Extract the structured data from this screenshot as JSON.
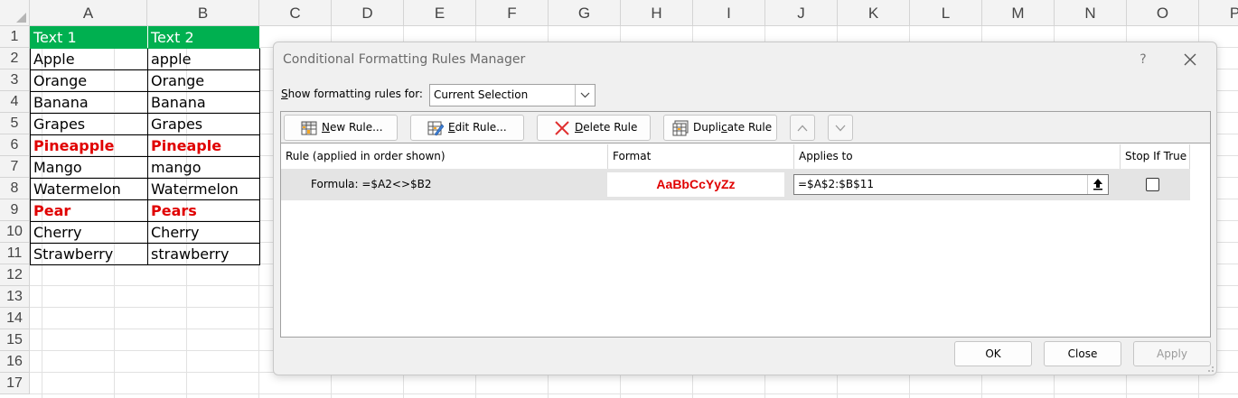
{
  "sheet": {
    "columns": [
      "A",
      "B",
      "C",
      "D",
      "E",
      "F",
      "G",
      "H",
      "I",
      "J",
      "K",
      "L",
      "M",
      "N",
      "O",
      "P"
    ],
    "rows": [
      "1",
      "2",
      "3",
      "4",
      "5",
      "6",
      "7",
      "8",
      "9",
      "10",
      "11",
      "12",
      "13",
      "14",
      "15",
      "16",
      "17"
    ],
    "header": {
      "a": "Text 1",
      "b": "Text 2"
    },
    "data": [
      {
        "a": "Apple",
        "b": "apple",
        "hl": false
      },
      {
        "a": "Orange",
        "b": "Orange",
        "hl": false
      },
      {
        "a": "Banana",
        "b": "Banana",
        "hl": false
      },
      {
        "a": "Grapes",
        "b": "Grapes",
        "hl": false
      },
      {
        "a": "Pineapple",
        "b": "Pineaple",
        "hl": true
      },
      {
        "a": "Mango",
        "b": "mango",
        "hl": false
      },
      {
        "a": "Watermelon",
        "b": "Watermelon",
        "hl": false
      },
      {
        "a": "Pear",
        "b": "Pears",
        "hl": true
      },
      {
        "a": "Cherry",
        "b": "Cherry",
        "hl": false
      },
      {
        "a": "Strawberry",
        "b": "strawberry",
        "hl": false
      }
    ],
    "colors": {
      "header_bg": "#00b050",
      "highlight": "#e00000"
    }
  },
  "dialog": {
    "title": "Conditional Formatting Rules Manager",
    "help": "?",
    "show_label_prefix": "S",
    "show_label_rest": "how formatting rules for:",
    "scope": "Current Selection",
    "toolbar": {
      "new_rule_u": "N",
      "new_rule_rest": "ew Rule...",
      "edit_rule_u": "E",
      "edit_rule_rest": "dit Rule...",
      "delete_rule_u": "D",
      "delete_rule_rest": "elete Rule",
      "duplicate_rule_pre": "Dupli",
      "duplicate_rule_u": "c",
      "duplicate_rule_post": "ate Rule"
    },
    "columns": {
      "rule": "Rule (applied in order shown)",
      "format": "Format",
      "applies": "Applies to",
      "stop": "Stop If True"
    },
    "rule": {
      "description": "Formula: =$A2<>$B2",
      "preview": "AaBbCcYyZz",
      "applies_to": "=$A$2:$B$11",
      "stop_if_true": false
    },
    "buttons": {
      "ok": "OK",
      "close": "Close",
      "apply": "Apply"
    }
  },
  "icons": [
    "new-rule-icon",
    "edit-rule-icon",
    "delete-rule-icon",
    "duplicate-rule-icon",
    "move-up-icon",
    "move-down-icon",
    "close-icon",
    "dropdown-arrow-icon",
    "collapse-dialog-icon"
  ]
}
